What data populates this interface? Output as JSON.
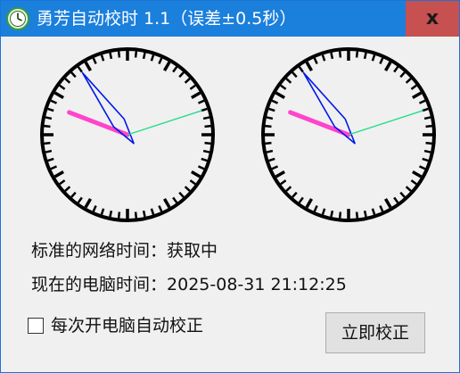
{
  "window": {
    "title": "勇芳自动校时 1.1（误差±0.5秒）",
    "close_label": "x"
  },
  "clocks": {
    "network": {
      "hour_hand": 9.7,
      "minute_hand": 54,
      "second_hand": 12
    },
    "computer": {
      "hour_hand": 9.7,
      "minute_hand": 54,
      "second_hand": 12
    }
  },
  "status": {
    "network_time_label": "标准的网络时间：",
    "network_time_value": "获取中",
    "pc_time_label": "现在的电脑时间：",
    "pc_time_value": "2025-08-31 21:12:25"
  },
  "options": {
    "auto_calibrate_label": "每次开电脑自动校正",
    "auto_calibrate_checked": false
  },
  "actions": {
    "calibrate_now_label": "立即校正"
  },
  "colors": {
    "titlebar": "#1b7fdc",
    "close_button": "#c75050",
    "hour_hand": "#ff44cc",
    "minute_hand": "#0018e8",
    "second_hand": "#22dd88"
  }
}
